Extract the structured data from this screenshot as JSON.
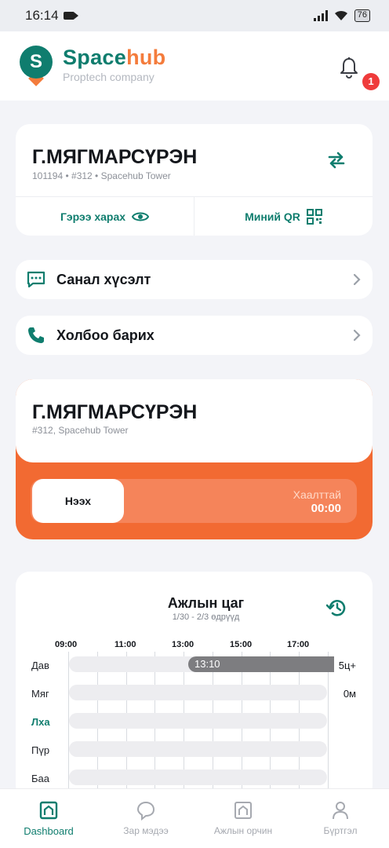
{
  "status_bar": {
    "time": "16:14",
    "battery": "76"
  },
  "header": {
    "brand_space": "Space",
    "brand_hub": "hub",
    "tagline": "Proptech company",
    "notification_count": "1",
    "logo_letter": "S"
  },
  "profile": {
    "name": "Г.МЯГМАРСҮРЭН",
    "details": "101194 • #312 • Spacehub Tower",
    "contract_label": "Гэрээ харах",
    "qr_label": "Миний QR"
  },
  "menu": [
    {
      "label": "Санал хүсэлт",
      "icon": "chat-icon"
    },
    {
      "label": "Холбоо барих",
      "icon": "phone-icon"
    }
  ],
  "door": {
    "name": "Г.МЯГМАРСҮРЭН",
    "location": "#312, Spacehub Tower",
    "open_label": "Нээх",
    "status": "Хаалттай",
    "timer": "00:00"
  },
  "worktime": {
    "title": "Ажлын цаг",
    "range": "1/30 - 2/3 өдрүүд",
    "hours": [
      "09:00",
      "11:00",
      "13:00",
      "15:00",
      "17:00"
    ],
    "days": [
      {
        "label": "Дав",
        "total": "5ц+",
        "start_label": "13:10",
        "today": false
      },
      {
        "label": "Мяг",
        "total": "0м",
        "start_label": "",
        "today": false
      },
      {
        "label": "Лха",
        "total": "",
        "start_label": "",
        "today": true
      },
      {
        "label": "Пүр",
        "total": "",
        "start_label": "",
        "today": false
      },
      {
        "label": "Баа",
        "total": "",
        "start_label": "",
        "today": false
      }
    ]
  },
  "tabs": [
    {
      "label": "Dashboard",
      "icon": "home-icon",
      "active": true
    },
    {
      "label": "Зар мэдээ",
      "icon": "message-icon",
      "active": false
    },
    {
      "label": "Ажлын орчин",
      "icon": "building-icon",
      "active": false
    },
    {
      "label": "Бүртгэл",
      "icon": "user-icon",
      "active": false
    }
  ],
  "colors": {
    "brand_green": "#0f7d6e",
    "brand_orange": "#f26a32",
    "badge_red": "#ef3b3b"
  }
}
